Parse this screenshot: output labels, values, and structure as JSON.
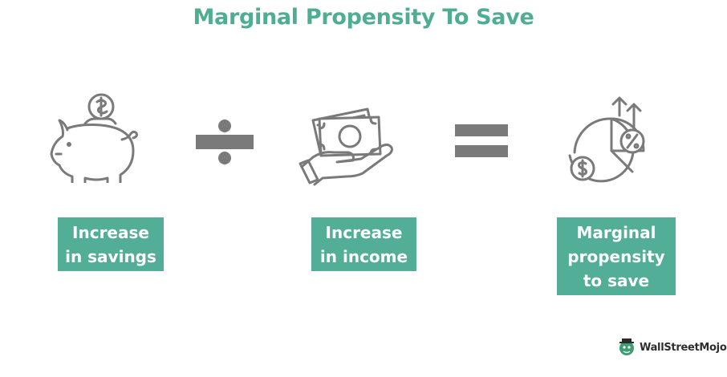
{
  "title": "Marginal Propensity To Save",
  "terms": [
    {
      "label": "Increase in savings",
      "icon": "piggy-bank-icon"
    },
    {
      "label": "Increase in income",
      "icon": "hand-money-icon"
    },
    {
      "label": "Marginal propensity to save",
      "icon": "growth-chart-icon"
    }
  ],
  "operators": {
    "divide": "divide-icon",
    "equals": "equals-icon"
  },
  "brand": {
    "name": "WallStreetMojo"
  },
  "colors": {
    "accent": "#52ae96",
    "title": "#4fad94",
    "icon": "#7a7a7a"
  }
}
